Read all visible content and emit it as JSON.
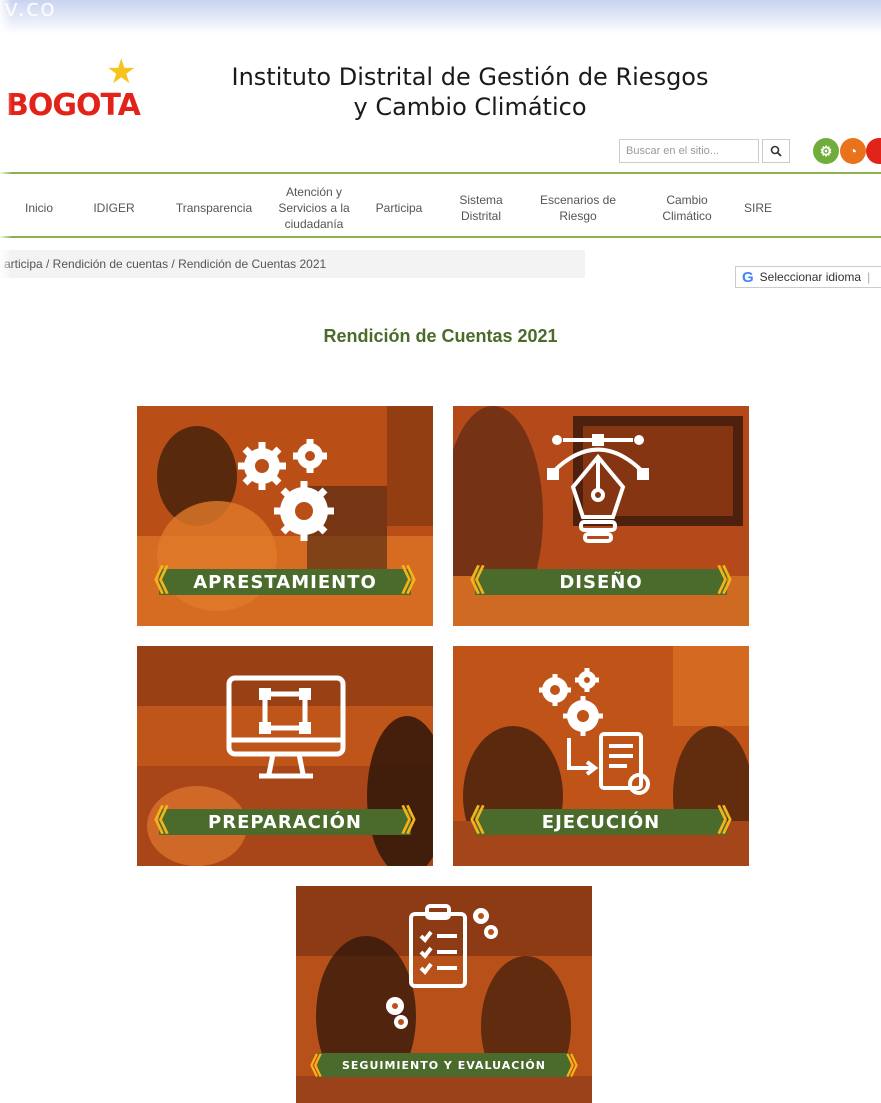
{
  "browser": {
    "url_fragment": "v.co"
  },
  "header": {
    "logo_text": "BOGOTA",
    "title_line1": "Instituto Distrital de Gestión de Riesgos",
    "title_line2": "y Cambio Climático",
    "search_placeholder": "Buscar en el sitio..."
  },
  "nav": {
    "items": [
      {
        "label": "Inicio"
      },
      {
        "label": "IDIGER"
      },
      {
        "label": "Transparencia"
      },
      {
        "label": "Atención y Servicios a la ciudadanía"
      },
      {
        "label": "Participa"
      },
      {
        "label": "Sistema Distrital"
      },
      {
        "label": "Escenarios de Riesgo"
      },
      {
        "label": "Cambio Climático"
      },
      {
        "label": "SIRE"
      }
    ]
  },
  "breadcrumb": "articipa / Rendición de cuentas / Rendición de Cuentas 2021",
  "language": {
    "label": "Seleccionar idioma"
  },
  "page": {
    "title": "Rendición de Cuentas 2021"
  },
  "cards": [
    {
      "label": "APRESTAMIENTO"
    },
    {
      "label": "DISEÑO"
    },
    {
      "label": "PREPARACIÓN"
    },
    {
      "label": "EJECUCIÓN"
    },
    {
      "label": "SEGUIMIENTO  Y  EVALUACIÓN"
    }
  ],
  "colors": {
    "accent_green": "#4a6b2c",
    "nav_line": "#8bb34c",
    "photo_orange": "#c9581b",
    "chevron_yellow": "#f5b31a",
    "logo_red": "#e2231a"
  },
  "icons": [
    "search-icon",
    "gears-icon",
    "pen-tool-bulb-icon",
    "monitor-icon",
    "gears-document-icon",
    "clipboard-checklist-icon",
    "google-icon"
  ]
}
